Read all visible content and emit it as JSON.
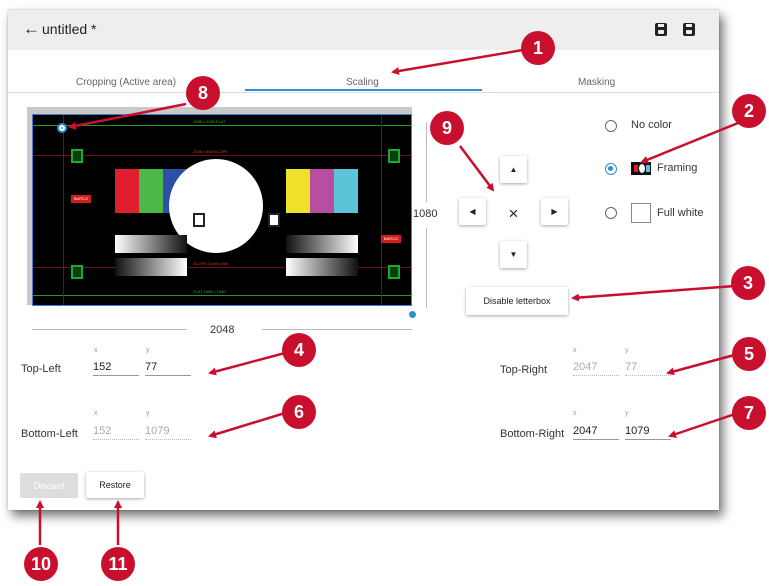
{
  "header": {
    "title": "untitled *",
    "back_icon": "arrow-left-icon",
    "save_icon": "save-icon",
    "save_as_icon": "save-as-icon"
  },
  "tabs": [
    {
      "label": "Cropping (Active area)",
      "active": false
    },
    {
      "label": "Scaling",
      "active": true
    },
    {
      "label": "Masking",
      "active": false
    }
  ],
  "preview": {
    "width_label": "2048",
    "height_label": "1080",
    "test_pattern": {
      "top_text": "1998 x 1080  FLAT",
      "scope_text": "2048 x 858  SCOPE",
      "bottom_text": "SCOPE  2048 x 858",
      "flat_text": "FLAT  1998 x 1080",
      "logo_text": "BARCO",
      "code_text": "1046978"
    }
  },
  "nav": {
    "up_icon": "triangle-up-icon",
    "down_icon": "triangle-down-icon",
    "left_icon": "triangle-left-icon",
    "right_icon": "triangle-right-icon",
    "center_icon": "close-icon",
    "center_glyph": "×"
  },
  "color_options": [
    {
      "label": "No color",
      "selected": false
    },
    {
      "label": "Framing",
      "selected": true
    },
    {
      "label": "Full white",
      "selected": false
    }
  ],
  "letterbox_button": "Disable letterbox",
  "corners": {
    "axis_x": "x",
    "axis_y": "y",
    "top_left": {
      "label": "Top-Left",
      "x": "152",
      "y": "77",
      "editable": true
    },
    "top_right": {
      "label": "Top-Right",
      "x": "2047",
      "y": "77",
      "editable": false
    },
    "bottom_left": {
      "label": "Bottom-Left",
      "x": "152",
      "y": "1079",
      "editable": false
    },
    "bottom_right": {
      "label": "Bottom-Right",
      "x": "2047",
      "y": "1079",
      "editable": true
    }
  },
  "footer": {
    "discard_label": "Discard",
    "restore_label": "Restore"
  },
  "callouts": [
    "1",
    "2",
    "3",
    "4",
    "5",
    "6",
    "7",
    "8",
    "9",
    "10",
    "11"
  ],
  "colors": {
    "accent": "#2e8fd0",
    "callout": "#c8102e",
    "titlebar": "#eeeeee"
  }
}
